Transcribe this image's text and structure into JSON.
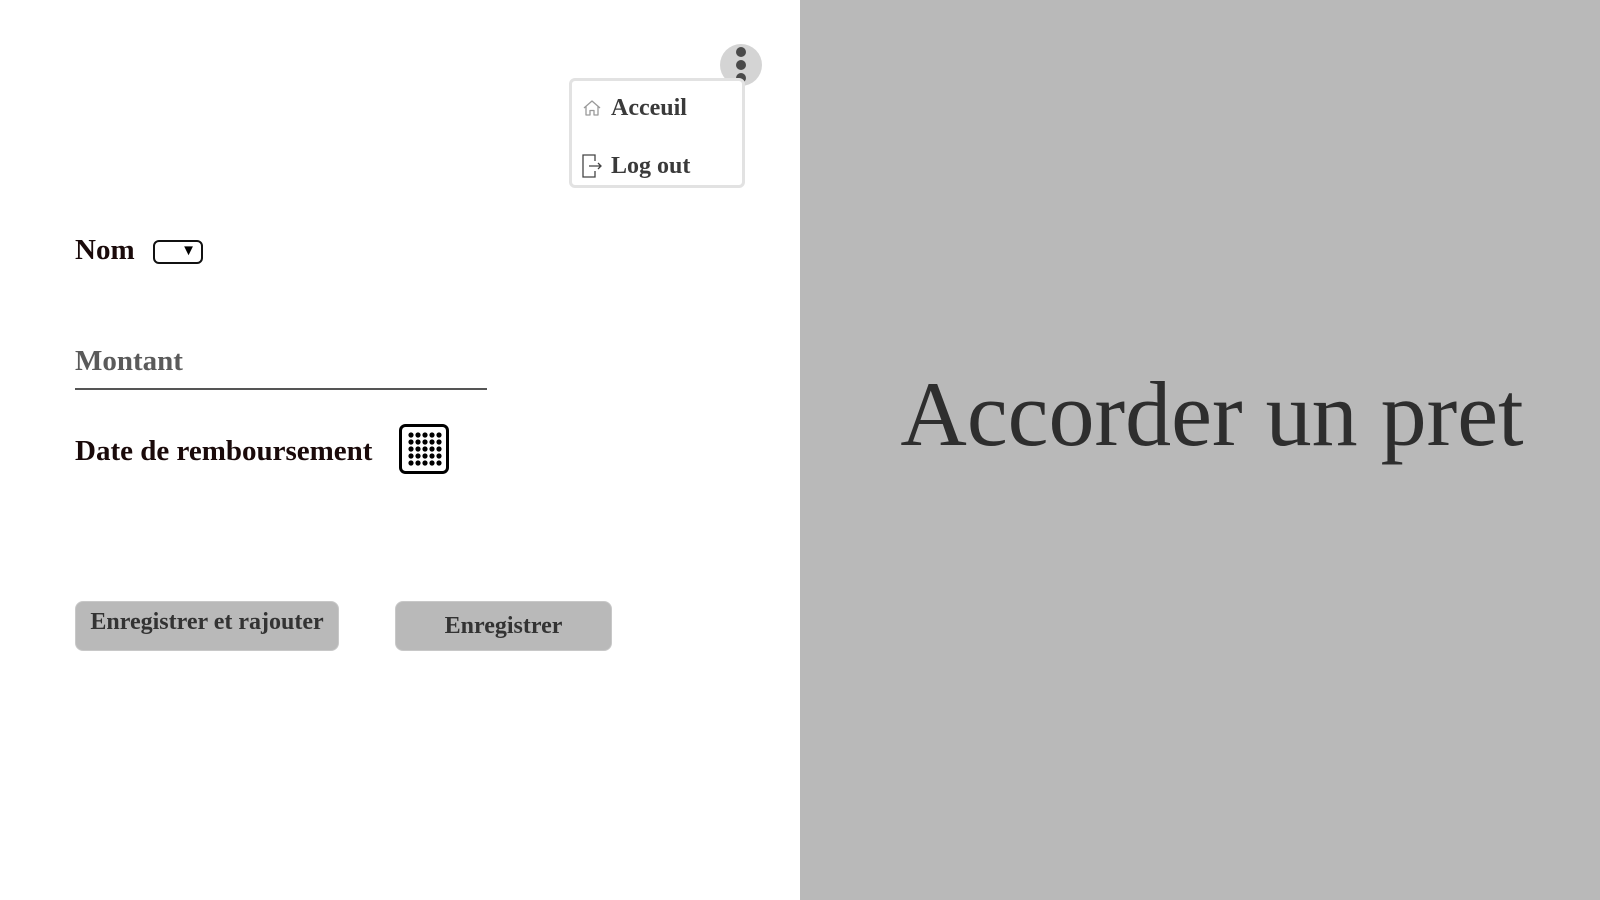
{
  "hero": {
    "title": "Accorder un pret"
  },
  "menu": {
    "trigger_icon": "more-vertical-icon",
    "items": [
      {
        "label": "Acceuil",
        "icon": "home-icon"
      },
      {
        "label": "Log out",
        "icon": "logout-icon"
      }
    ]
  },
  "form": {
    "nom_label": "Nom",
    "nom_select_icon": "dropdown-arrow-icon",
    "montant_placeholder": "Montant",
    "montant_value": "",
    "date_label": "Date de remboursement",
    "date_icon": "calendar-icon"
  },
  "actions": {
    "save_and_add_label": "Enregistrer et rajouter",
    "save_label": "Enregistrer"
  },
  "colors": {
    "right_panel_bg": "#b9b9b9",
    "button_bg": "#b9b9b9",
    "label_text": "#1a0a0a",
    "hero_text": "#2e2e2e"
  }
}
